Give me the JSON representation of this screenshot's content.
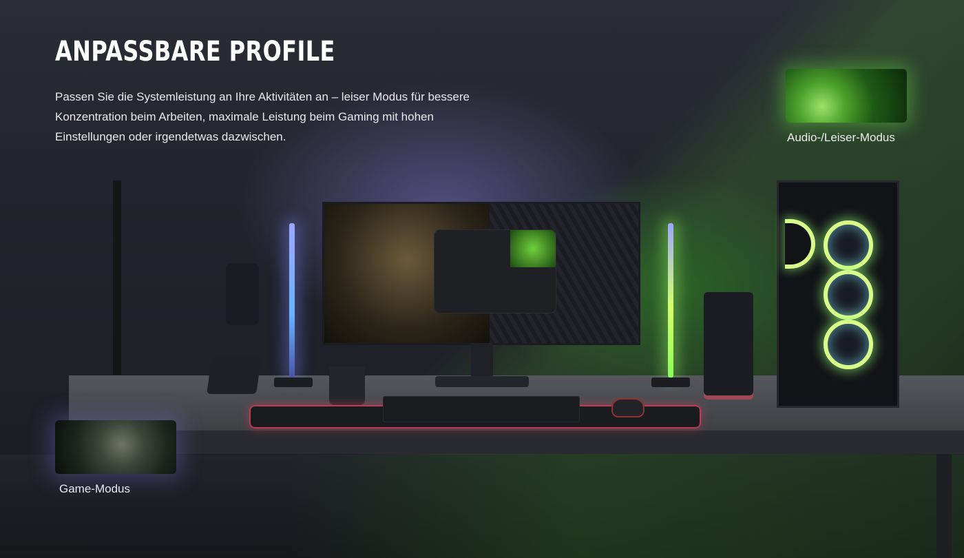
{
  "header": {
    "title": "ANPASSBARE PROFILE",
    "description": "Passen Sie die Systemleistung an Ihre Aktivitäten an – leiser Modus für bessere Konzentration beim Arbeiten, maximale Leistung beim Gaming mit hohen Einstellungen oder irgendetwas dazwischen."
  },
  "modes": {
    "audio": {
      "label": "Audio-/Leiser-Modus",
      "accent": "#7cff4a"
    },
    "game": {
      "label": "Game-Modus",
      "accent": "#8a7cff"
    }
  }
}
